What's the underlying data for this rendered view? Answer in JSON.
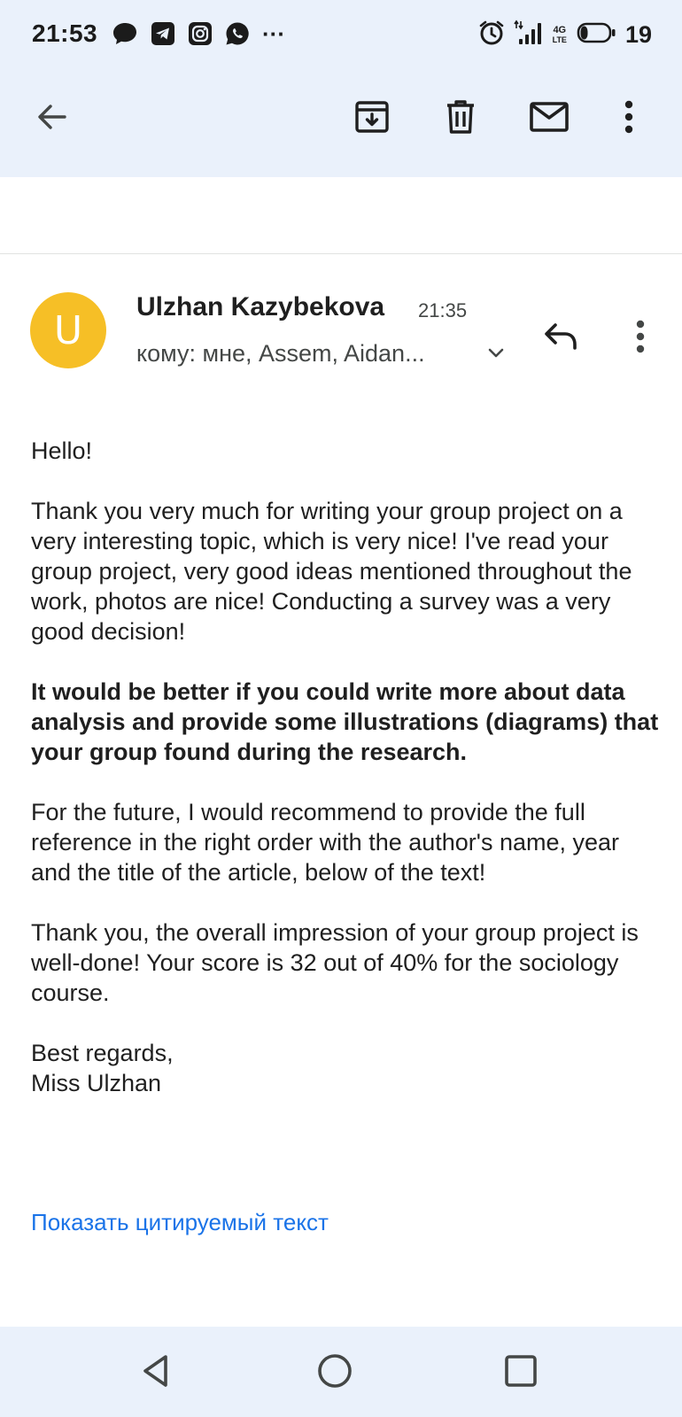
{
  "status_bar": {
    "time": "21:53",
    "more_notifications": "···",
    "network_type_top": "4G",
    "network_type_bottom": "LTE",
    "battery_level": "19",
    "notification_icons": [
      "chat-bubble-icon",
      "telegram-icon",
      "instagram-icon",
      "whatsapp-icon"
    ]
  },
  "toolbar": {
    "icons": [
      "back-arrow-icon",
      "archive-icon",
      "delete-icon",
      "mark-unread-icon",
      "more-vert-icon"
    ]
  },
  "message": {
    "avatar_letter": "U",
    "avatar_color": "#f6bf26",
    "sender_name": "Ulzhan Kazybekova",
    "time": "21:35",
    "recipients": "кому: мне, Assem, Aidan...",
    "paragraphs": {
      "greeting": "Hello!",
      "p1": "Thank you very much for writing your group project on a very interesting topic, which is very nice! I've read your group project, very good ideas mentioned throughout the work, photos are nice! Conducting a survey was a very good decision!",
      "p2": "It would be better if you could write more about data analysis and provide some illustrations (diagrams) that your group found during the research.",
      "p3": "For the future, I would recommend to provide the full reference in the right order with the author's name, year and the title of the article, below of the text!",
      "p4": "Thank you, the overall impression of your group project is well-done! Your score is 32 out of 40% for the sociology course.",
      "closing": "Best regards,",
      "signature": "Miss Ulzhan"
    },
    "show_quoted_text": "Показать цитируемый текст"
  },
  "colors": {
    "header_bg": "#eaf1fb",
    "link": "#1a73e8",
    "text": "#1f1f1f"
  }
}
